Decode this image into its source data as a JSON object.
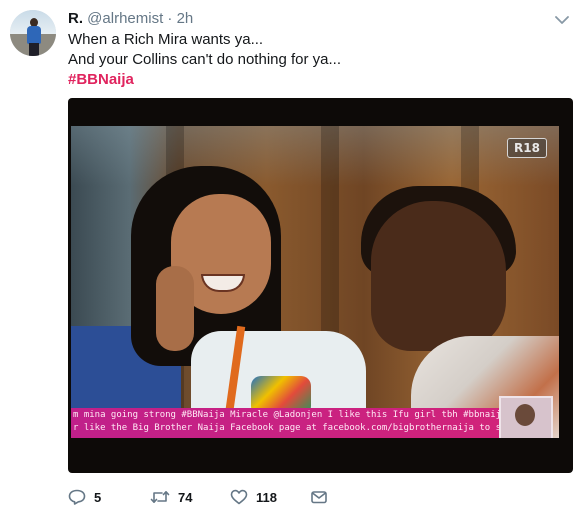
{
  "tweet": {
    "author_name": "R.",
    "author_handle": "@alrhemist",
    "dot": "·",
    "time": "2h",
    "line1": "When a Rich Mira wants ya...",
    "line2": "And your Collins can't do nothing for ya...",
    "hashtag": "#BBNaija"
  },
  "media": {
    "rating_badge": "R18",
    "ticker_line1": "m mina going strong #BBNaija Miracle  @Ladonjen I like this Ifu girl tbh #bbnaija",
    "ticker_line2": "r like the Big Brother Naija Facebook page at facebook.com/bigbrothernaija to stay up to date"
  },
  "actions": {
    "reply_count": "5",
    "retweet_count": "74",
    "like_count": "118",
    "icons": [
      "reply-icon",
      "retweet-icon",
      "like-icon",
      "direct-message-icon"
    ]
  },
  "colors": {
    "hashtag": "#e0245e",
    "muted_text": "#657786",
    "primary_text": "#14171a"
  }
}
